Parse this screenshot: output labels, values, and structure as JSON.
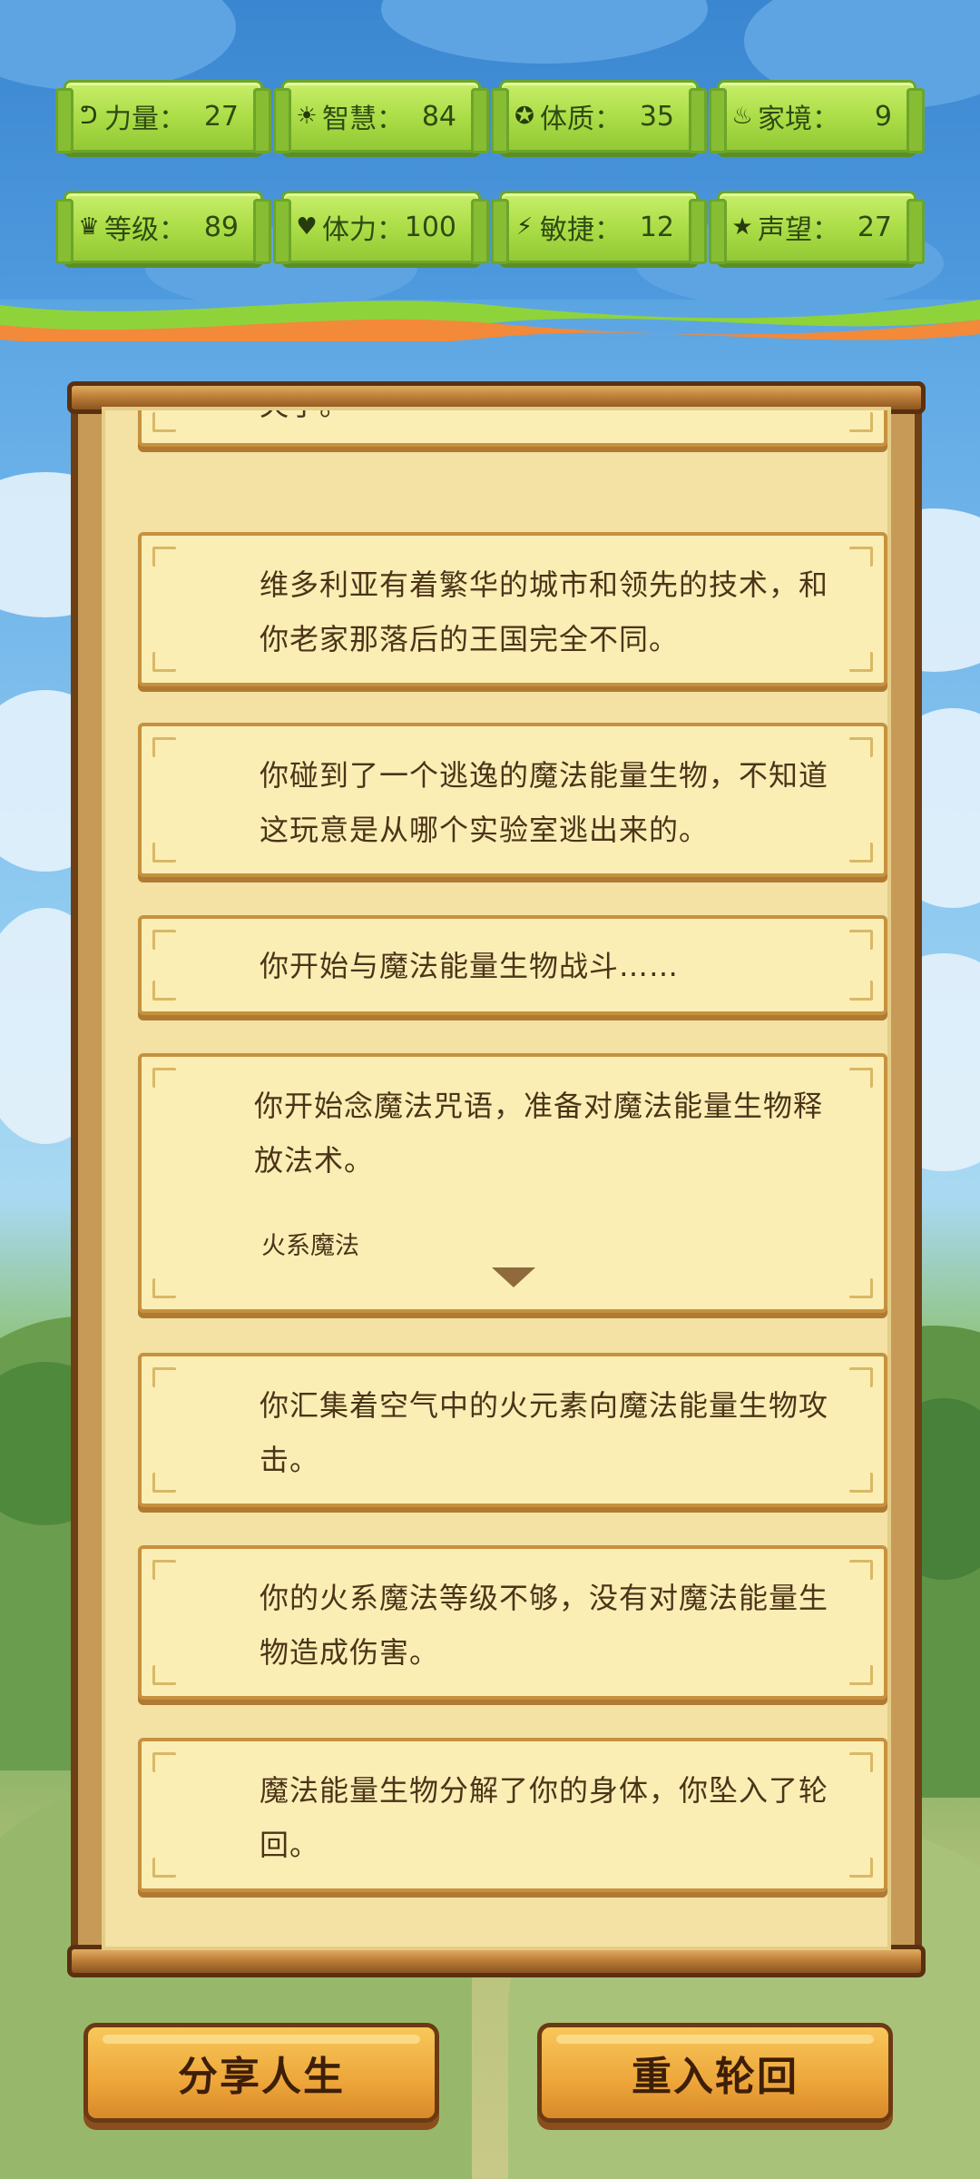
{
  "stats": [
    {
      "icon": "muscle-icon",
      "glyph": "ᕤ",
      "label": "力量：",
      "value": "27"
    },
    {
      "icon": "bulb-icon",
      "glyph": "☀",
      "label": "智慧：",
      "value": "84"
    },
    {
      "icon": "constitution-icon",
      "glyph": "✪",
      "label": "体质：",
      "value": "35"
    },
    {
      "icon": "family-icon",
      "glyph": "♨",
      "label": "家境：",
      "value": "9"
    },
    {
      "icon": "crown-icon",
      "glyph": "♛",
      "label": "等级：",
      "value": "89"
    },
    {
      "icon": "heart-icon",
      "glyph": "♥",
      "label": "体力：",
      "value": "100"
    },
    {
      "icon": "lightning-icon",
      "glyph": "⚡",
      "label": "敏捷：",
      "value": "12"
    },
    {
      "icon": "star-icon",
      "glyph": "★",
      "label": "声望：",
      "value": "27"
    }
  ],
  "log": {
    "partial_top": "失了。",
    "entries": [
      {
        "text": "维多利亚有着繁华的城市和领先的技术，和你老家那落后的王国完全不同。"
      },
      {
        "text": "你碰到了一个逃逸的魔法能量生物，不知道这玩意是从哪个实验室逃出来的。"
      },
      {
        "text": "你开始与魔法能量生物战斗……"
      },
      {
        "text": "你开始念魔法咒语，准备对魔法能量生物释放法术。",
        "sub": "火系魔法"
      },
      {
        "text": "你汇集着空气中的火元素向魔法能量生物攻击。"
      },
      {
        "text": "你的火系魔法等级不够，没有对魔法能量生物造成伤害。"
      },
      {
        "text": "魔法能量生物分解了你的身体，你坠入了轮回。"
      }
    ]
  },
  "buttons": {
    "share": "分享人生",
    "restart": "重入轮回"
  },
  "colors": {
    "stat_bg": "#a9dc45",
    "card_bg": "#fbeeb5",
    "button_bg": "#eda63a",
    "frame": "#6e4016"
  }
}
